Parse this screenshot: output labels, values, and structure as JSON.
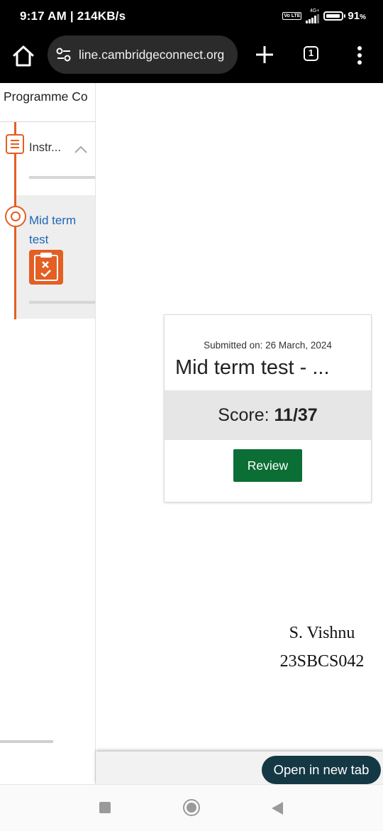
{
  "status_bar": {
    "time": "9:17 AM | 214KB/s",
    "volte": "Vo LTE",
    "network": "4G+",
    "battery_percent": "91",
    "battery_unit": "%",
    "battery_level": 0.91
  },
  "browser": {
    "url": "line.cambridgeconnect.org",
    "tab_count": "1",
    "icons": [
      "home-icon",
      "site-settings-icon",
      "plus-icon",
      "tabs-icon",
      "more-icon"
    ]
  },
  "course_panel": {
    "title": "Programme Co",
    "items": [
      {
        "label": "Instr...",
        "icon": "document-icon"
      },
      {
        "label": "Mid term test",
        "icon": "circle-icon",
        "badge_icon": "test-result-icon"
      }
    ]
  },
  "result_card": {
    "submitted": "Submitted on: 26 March, 2024",
    "title": "Mid term test - ...",
    "score_label": "Score:",
    "score_value": "11/37",
    "review_label": "Review"
  },
  "handwritten": {
    "name": "S. Vishnu",
    "id": "23SBCS042"
  },
  "bottom_bar": {
    "open_new_tab": "Open in new tab"
  },
  "colors": {
    "accent_orange": "#e35f23",
    "link_blue": "#1f66b7",
    "review_green": "#0b6e35",
    "toast_dark": "#153845"
  }
}
